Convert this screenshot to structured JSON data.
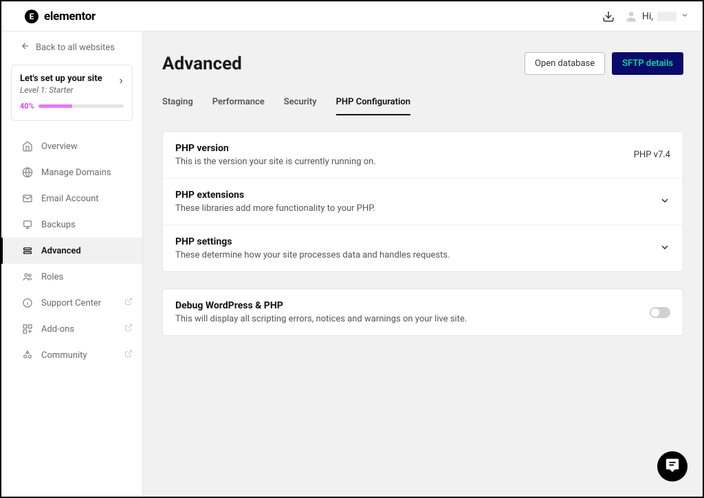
{
  "brand": {
    "name": "elementor",
    "logo_letter": "E"
  },
  "header": {
    "greeting": "Hi,"
  },
  "sidebar": {
    "back_label": "Back to all websites",
    "setup": {
      "title": "Let's set up your site",
      "level": "Level 1: Starter",
      "progress_pct": "40%",
      "progress_value": 40
    },
    "nav": {
      "overview": "Overview",
      "manage_domains": "Manage Domains",
      "email_account": "Email Account",
      "backups": "Backups",
      "advanced": "Advanced",
      "roles": "Roles",
      "support_center": "Support Center",
      "addons": "Add-ons",
      "community": "Community"
    }
  },
  "page": {
    "title": "Advanced",
    "open_database": "Open database",
    "sftp_details": "SFTP details",
    "tabs": {
      "staging": "Staging",
      "performance": "Performance",
      "security": "Security",
      "php_config": "PHP Configuration"
    },
    "rows": {
      "php_version": {
        "title": "PHP version",
        "desc": "This is the version your site is currently running on.",
        "value": "PHP v7.4"
      },
      "php_extensions": {
        "title": "PHP extensions",
        "desc": "These libraries add more functionality to your PHP."
      },
      "php_settings": {
        "title": "PHP settings",
        "desc": "These determine how your site processes data and handles requests."
      },
      "debug": {
        "title": "Debug WordPress & PHP",
        "desc": "This will display all scripting errors, notices and warnings on your live site."
      }
    }
  }
}
